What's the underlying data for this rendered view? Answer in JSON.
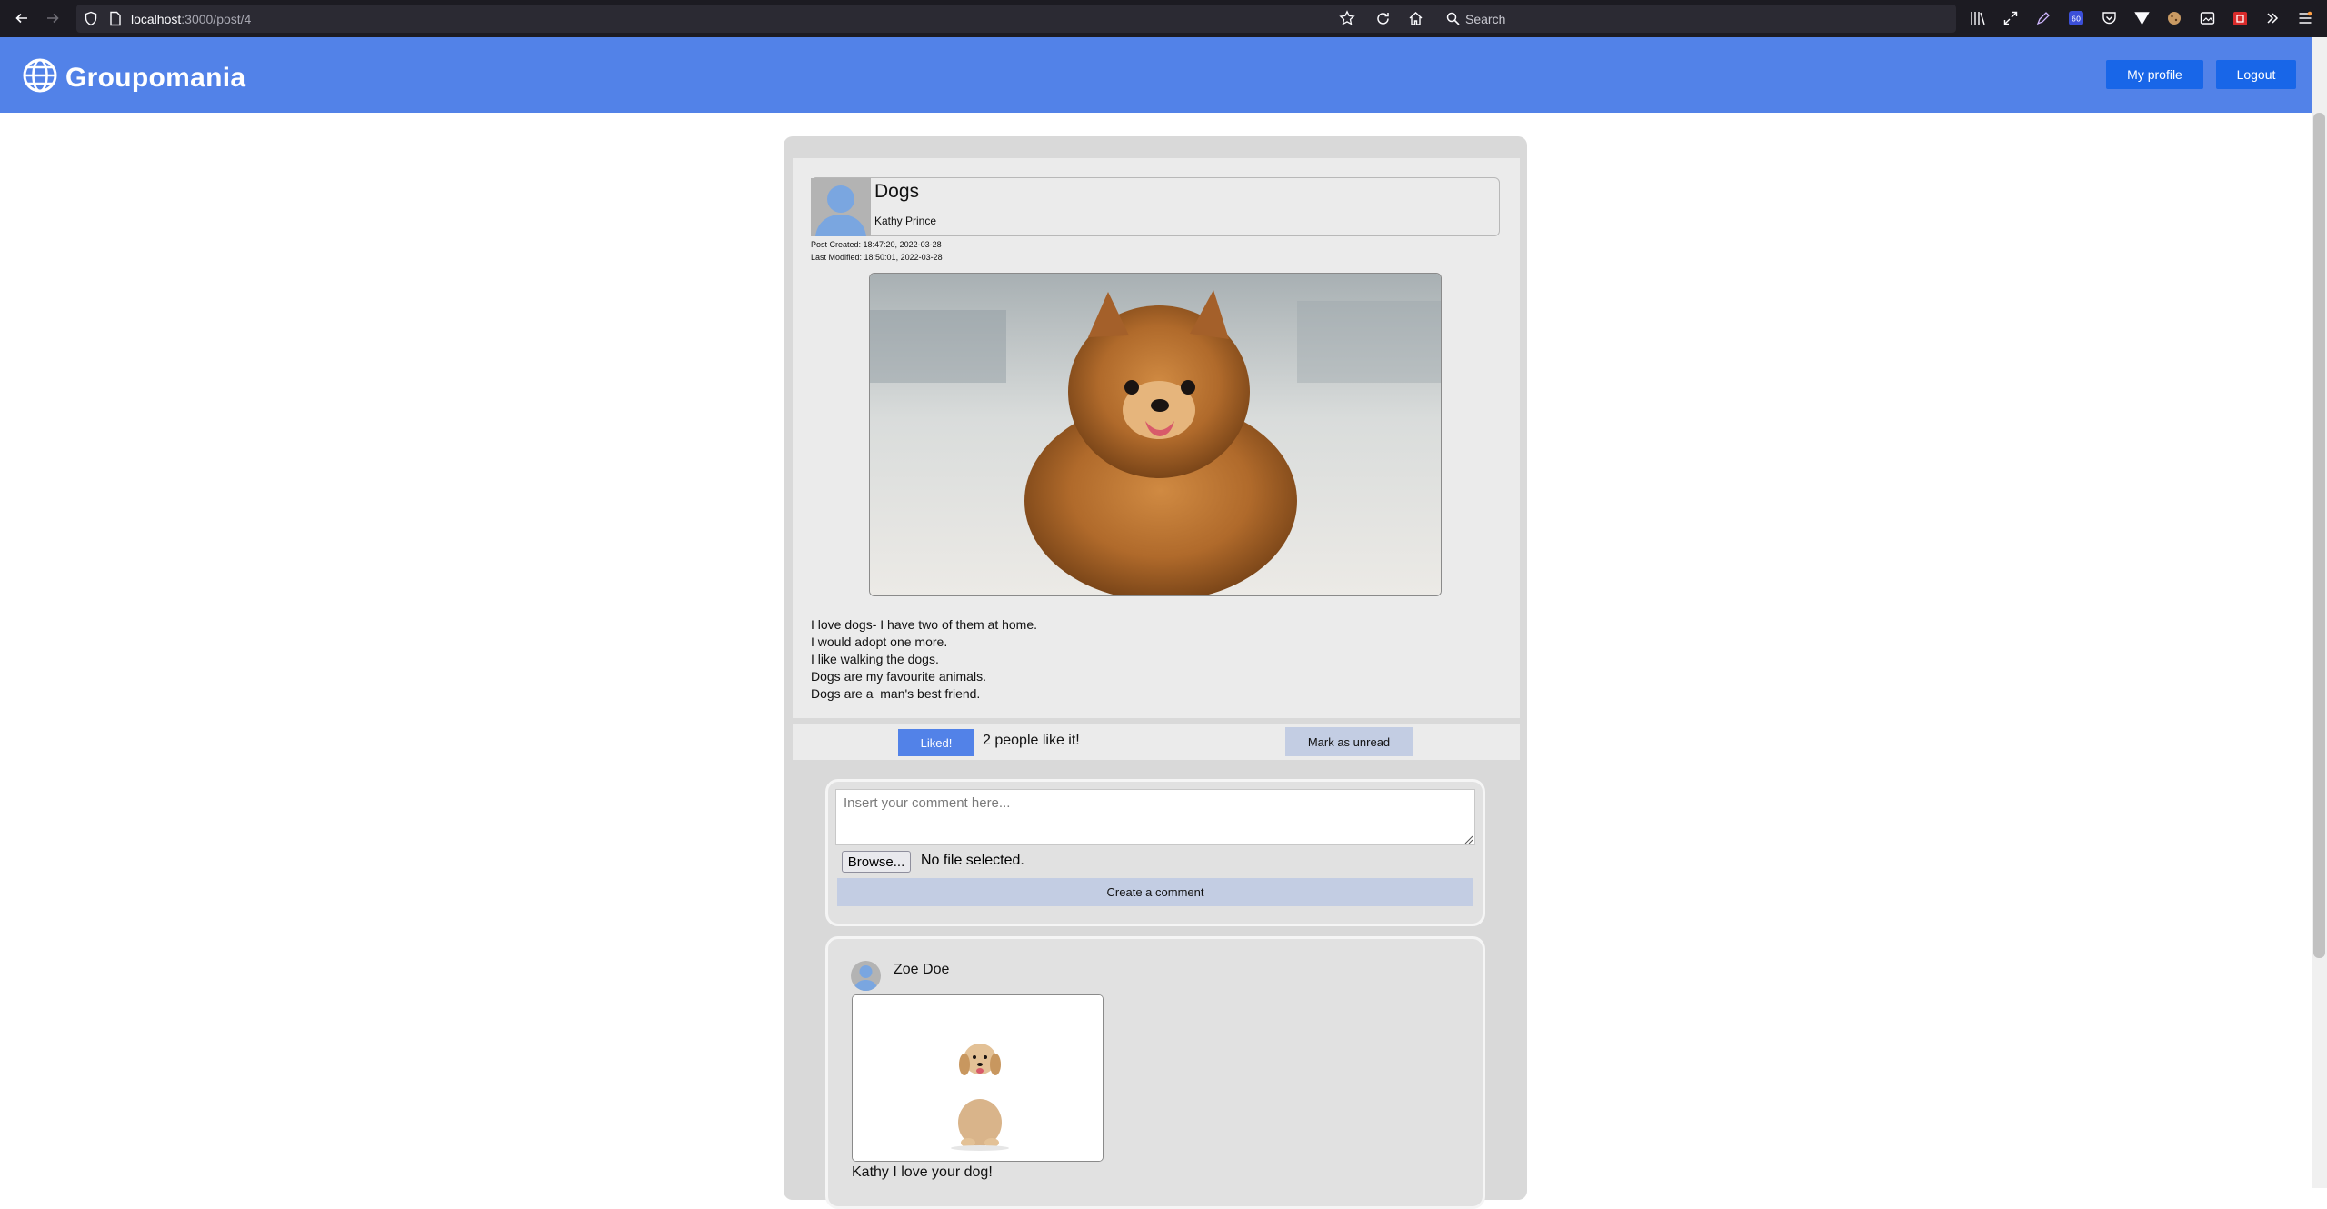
{
  "browser": {
    "url_host": "localhost",
    "url_path": ":3000/post/4",
    "search_placeholder": "Search"
  },
  "header": {
    "brand": "Groupomania",
    "my_profile": "My profile",
    "logout": "Logout",
    "color": "#5282e8",
    "button_color": "#1866e8"
  },
  "post": {
    "title": "Dogs",
    "author": "Kathy Prince",
    "created": "Post Created: 18:47:20, 2022-03-28",
    "modified": "Last Modified: 18:50:01, 2022-03-28",
    "lines": [
      "I love dogs- I have two of them at home.",
      "I would adopt one more.",
      "I like walking the dogs.",
      "Dogs are my favourite animals.",
      "Dogs are a  man's best friend."
    ],
    "liked_label": "Liked!",
    "likes_text": "2 people like it!",
    "mark_unread": "Mark as unread"
  },
  "comment_form": {
    "placeholder": "Insert your comment here...",
    "browse": "Browse...",
    "file_status": "No file selected.",
    "submit": "Create a comment"
  },
  "comments": [
    {
      "author": "Zoe Doe",
      "lines": [
        "Kathy I love your dog!"
      ]
    }
  ],
  "icons": [
    "back-icon",
    "forward-icon",
    "shield-icon",
    "page-icon",
    "star-icon",
    "reload-icon",
    "home-icon",
    "search-icon",
    "library-icon",
    "fullscreen-icon",
    "pen-icon",
    "extension-icon",
    "pocket-icon",
    "vpn-icon",
    "cookie-icon",
    "screenshot-icon",
    "extension-red-icon",
    "overflow-icon",
    "menu-icon",
    "globe-icon",
    "avatar-icon"
  ]
}
